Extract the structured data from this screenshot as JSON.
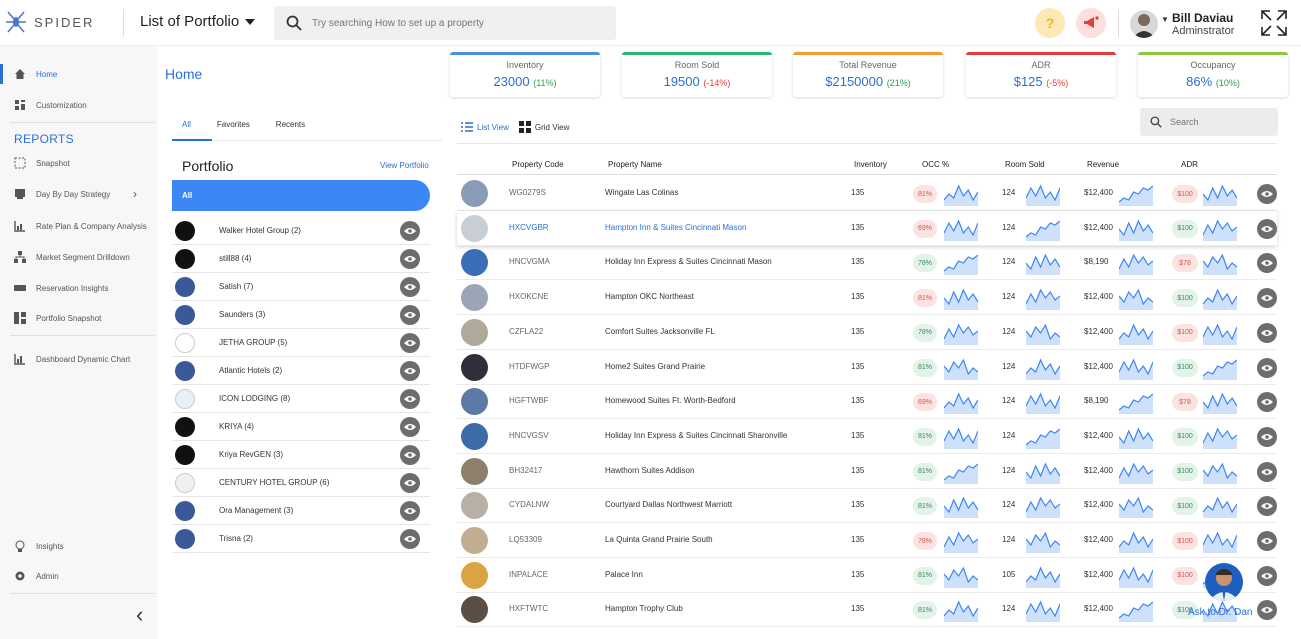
{
  "app": {
    "logo_text": "SPIDER",
    "portfolio_select": "List of Portfolio",
    "search_placeholder": "Try searching How to set up a property",
    "user_name": "Bill Daviau",
    "user_role": "Adminstrator"
  },
  "sidebar": {
    "items": [
      {
        "label": "Home",
        "icon": "home-icon"
      },
      {
        "label": "Customization",
        "icon": "customization-icon"
      },
      {
        "label": "Snapshot",
        "icon": "snapshot-icon"
      },
      {
        "label": "Day By Day Strategy",
        "icon": "strategy-icon"
      },
      {
        "label": "Rate Plan & Company Analysis",
        "icon": "rate-plan-icon"
      },
      {
        "label": "Market Segment Drilldown",
        "icon": "market-segment-icon"
      },
      {
        "label": "Reservation Insights",
        "icon": "reservation-icon"
      },
      {
        "label": "Portfolio Snapshot",
        "icon": "portfolio-snapshot-icon"
      },
      {
        "label": "Dashboard Dynamic Chart",
        "icon": "dashboard-chart-icon"
      },
      {
        "label": "Insights",
        "icon": "insights-icon"
      },
      {
        "label": "Admin",
        "icon": "admin-gear-icon"
      }
    ],
    "reports_title": "REPORTS"
  },
  "page_title": "Home",
  "kpis": [
    {
      "label": "Inventory",
      "value": "23000",
      "change": "(11%)",
      "trend": "up",
      "color": "#4a90e2"
    },
    {
      "label": "Room Sold",
      "value": "19500",
      "change": "(-14%)",
      "trend": "down",
      "color": "#2bb673"
    },
    {
      "label": "Total Revenue",
      "value": "$2150000",
      "change": "(21%)",
      "trend": "up",
      "color": "#f39c34"
    },
    {
      "label": "ADR",
      "value": "$125",
      "change": "(-5%)",
      "trend": "down",
      "color": "#e23b3b"
    },
    {
      "label": "Occupancy",
      "value": "86%",
      "change": "(10%)",
      "trend": "up",
      "color": "#8cc63f"
    }
  ],
  "left_panel": {
    "tabs": [
      "All",
      "Favorites",
      "Recents"
    ],
    "title": "Portfolio",
    "view_link": "View Portfolio",
    "all_label": "All",
    "portfolios": [
      "Walker Hotel Group (2)",
      "still88 (4)",
      "Satish (7)",
      "Saunders (3)",
      "JETHA GROUP (5)",
      "Atlantic Hotels (2)",
      "ICON LODGING (8)",
      "KRIYA (4)",
      "Kriya RevGEN (3)",
      "CENTURY HOTEL GROUP (6)",
      "Ora Management (3)",
      "Trisna (2)"
    ]
  },
  "table": {
    "view_tabs": [
      "List View",
      "Grid View"
    ],
    "search_placeholder": "Search",
    "headers": [
      "Property Code",
      "Property Name",
      "Inventory",
      "OCC %",
      "Room Sold",
      "Revenue",
      "ADR"
    ],
    "rows": [
      {
        "code": "WG0279S",
        "name": "Wingate Las Colinas",
        "inventory": "135",
        "occ": "81%",
        "occ_color": "red",
        "sold": "124",
        "revenue": "$12,400",
        "adr": "$100",
        "adr_color": "red"
      },
      {
        "code": "HXCVGBR",
        "name": "Hampton Inn & Suites Cincinnati Mason",
        "inventory": "135",
        "occ": "69%",
        "occ_color": "red",
        "sold": "124",
        "revenue": "$12,400",
        "adr": "$100",
        "adr_color": "green"
      },
      {
        "code": "HNCVGMA",
        "name": "Holiday Inn Express & Suites Cincinnati Mason",
        "inventory": "135",
        "occ": "78%",
        "occ_color": "green",
        "sold": "124",
        "revenue": "$8,190",
        "adr": "$78",
        "adr_color": "red"
      },
      {
        "code": "HXOKCNE",
        "name": "Hampton OKC Northeast",
        "inventory": "135",
        "occ": "81%",
        "occ_color": "red",
        "sold": "124",
        "revenue": "$12,400",
        "adr": "$100",
        "adr_color": "green"
      },
      {
        "code": "CZFLA22",
        "name": "Comfort Suites Jacksonville FL",
        "inventory": "135",
        "occ": "78%",
        "occ_color": "green",
        "sold": "124",
        "revenue": "$12,400",
        "adr": "$100",
        "adr_color": "red"
      },
      {
        "code": "HTDFWGP",
        "name": "Home2 Suites Grand Prairie",
        "inventory": "135",
        "occ": "81%",
        "occ_color": "green",
        "sold": "124",
        "revenue": "$12,400",
        "adr": "$100",
        "adr_color": "green"
      },
      {
        "code": "HGFTWBF",
        "name": "Homewood Suites Ft. Worth-Bedford",
        "inventory": "135",
        "occ": "69%",
        "occ_color": "red",
        "sold": "124",
        "revenue": "$8,190",
        "adr": "$78",
        "adr_color": "red"
      },
      {
        "code": "HNCVGSV",
        "name": "Holiday Inn Express & Suites Cincinnati Sharonville",
        "inventory": "135",
        "occ": "81%",
        "occ_color": "green",
        "sold": "124",
        "revenue": "$12,400",
        "adr": "$100",
        "adr_color": "green"
      },
      {
        "code": "BH32417",
        "name": "Hawthorn Suites Addison",
        "inventory": "135",
        "occ": "81%",
        "occ_color": "green",
        "sold": "124",
        "revenue": "$12,400",
        "adr": "$100",
        "adr_color": "green"
      },
      {
        "code": "CYDALNW",
        "name": "Courtyard Dallas Northwest Marriott",
        "inventory": "135",
        "occ": "81%",
        "occ_color": "green",
        "sold": "124",
        "revenue": "$12,400",
        "adr": "$100",
        "adr_color": "green"
      },
      {
        "code": "LQ53309",
        "name": "La Quinta Grand Prairie South",
        "inventory": "135",
        "occ": "78%",
        "occ_color": "red",
        "sold": "124",
        "revenue": "$12,400",
        "adr": "$100",
        "adr_color": "red"
      },
      {
        "code": "INPALACE",
        "name": "Palace Inn",
        "inventory": "135",
        "occ": "81%",
        "occ_color": "green",
        "sold": "105",
        "revenue": "$12,400",
        "adr": "$100",
        "adr_color": "red"
      },
      {
        "code": "HXFTWTC",
        "name": "Hampton Trophy Club",
        "inventory": "135",
        "occ": "81%",
        "occ_color": "green",
        "sold": "124",
        "revenue": "$12,400",
        "adr": "$100",
        "adr_color": "green"
      }
    ]
  },
  "ask_bot_label": "Ask to Dr. Dan"
}
